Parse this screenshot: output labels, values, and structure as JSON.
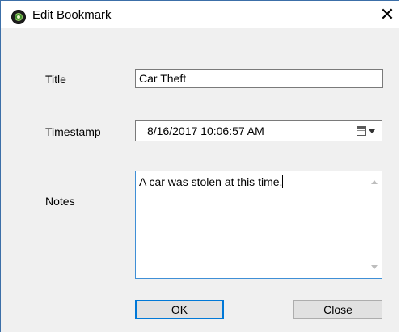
{
  "window": {
    "title": "Edit Bookmark",
    "close_glyph": "✕",
    "icon": "app-target-icon"
  },
  "form": {
    "title_label": "Title",
    "title_value": "Car Theft",
    "timestamp_label": "Timestamp",
    "timestamp_value": "8/16/2017 10:06:57 AM",
    "timestamp_picker_icon": "calendar-dropdown-icon",
    "notes_label": "Notes",
    "notes_value": "A car was stolen at this time."
  },
  "buttons": {
    "ok_label": "OK",
    "close_label": "Close"
  },
  "colors": {
    "focus_border": "#0078d7",
    "notes_border": "#3f8fd6",
    "dialog_background": "#f0f0f0"
  }
}
